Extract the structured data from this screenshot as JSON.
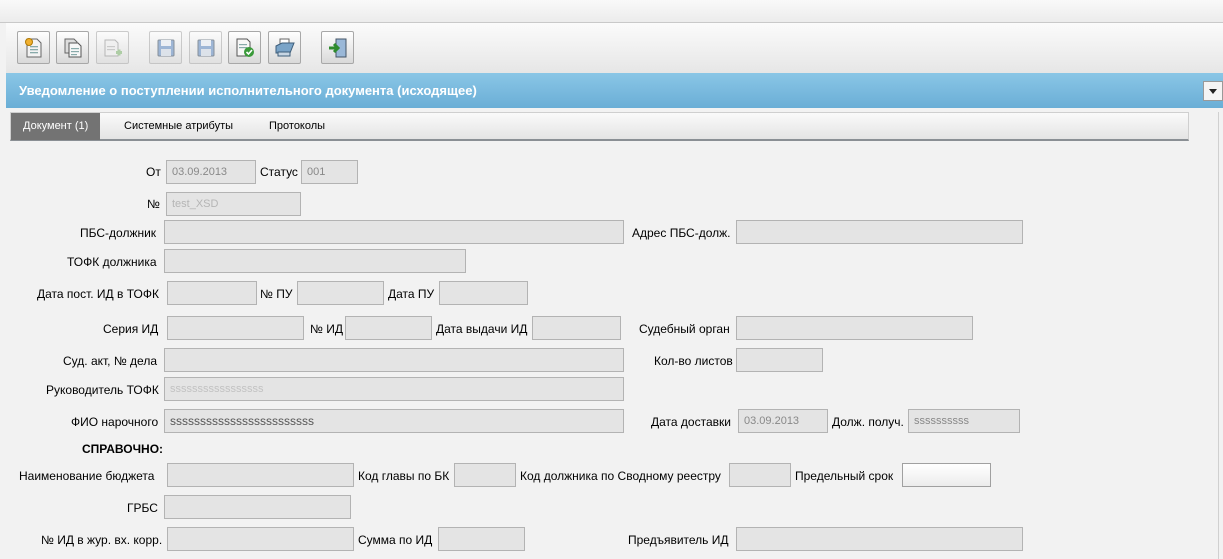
{
  "window": {
    "title": "Уведомление о поступлении исполнительного документа (исходящее)"
  },
  "toolbar": {
    "buttons": [
      {
        "icon": "new-document-icon"
      },
      {
        "icon": "copy-document-icon"
      },
      {
        "icon": "add-document-icon"
      },
      {
        "icon": "save-as-icon"
      },
      {
        "icon": "save-icon"
      },
      {
        "icon": "document-check-icon"
      },
      {
        "icon": "print-icon"
      },
      {
        "icon": "exit-icon"
      }
    ]
  },
  "tabs": [
    "Документ (1)",
    "Системные атрибуты",
    "Протоколы"
  ],
  "form": {
    "ot": {
      "label": "От",
      "value": "03.09.2013"
    },
    "status": {
      "label": "Статус",
      "value": "001"
    },
    "number": {
      "label": "№",
      "value": "test_XSD"
    },
    "pbs_debtor": {
      "label": "ПБС-должник",
      "value": ""
    },
    "pbs_address": {
      "label": "Адрес ПБС-долж.",
      "value": ""
    },
    "tofk_debtor": {
      "label": "ТОФК должника",
      "value": ""
    },
    "date_post": {
      "label": "Дата пост. ИД в ТОФК",
      "value": ""
    },
    "nom_pu": {
      "label": "№ ПУ",
      "value": ""
    },
    "date_pu": {
      "label": "Дата ПУ",
      "value": ""
    },
    "series_id": {
      "label": "Серия ИД",
      "value": ""
    },
    "nom_id": {
      "label": "№ ИД",
      "value": ""
    },
    "date_issue": {
      "label": "Дата выдачи ИД",
      "value": ""
    },
    "court": {
      "label": "Судебный орган",
      "value": ""
    },
    "court_act": {
      "label": "Суд. акт, № дела",
      "value": ""
    },
    "sheets": {
      "label": "Кол-во листов",
      "value": ""
    },
    "head_tofk": {
      "label": "Руководитель ТОФК",
      "value": "sssssssssssssssss"
    },
    "courier": {
      "label": "ФИО нарочного",
      "value": "ssssssssssssssssssssssss"
    },
    "delivery_date": {
      "label": "Дата доставки",
      "value": "03.09.2013"
    },
    "recipient_pos": {
      "label": "Долж. получ.",
      "value": "ssssssssss"
    },
    "reference_header": "СПРАВОЧНО:",
    "budget_name": {
      "label": "Наименование бюджета",
      "value": ""
    },
    "bk_code": {
      "label": "Код главы по БК",
      "value": ""
    },
    "debtor_code": {
      "label": "Код должника по Сводному реестру",
      "value": ""
    },
    "deadline": {
      "label": "Предельный срок",
      "value": ""
    },
    "grbs": {
      "label": "ГРБС",
      "value": ""
    },
    "journal_no": {
      "label": "№ ИД в жур. вх. корр.",
      "value": ""
    },
    "sum_id": {
      "label": "Сумма по ИД",
      "value": ""
    },
    "presenter": {
      "label": "Предъявитель ИД",
      "value": ""
    }
  }
}
